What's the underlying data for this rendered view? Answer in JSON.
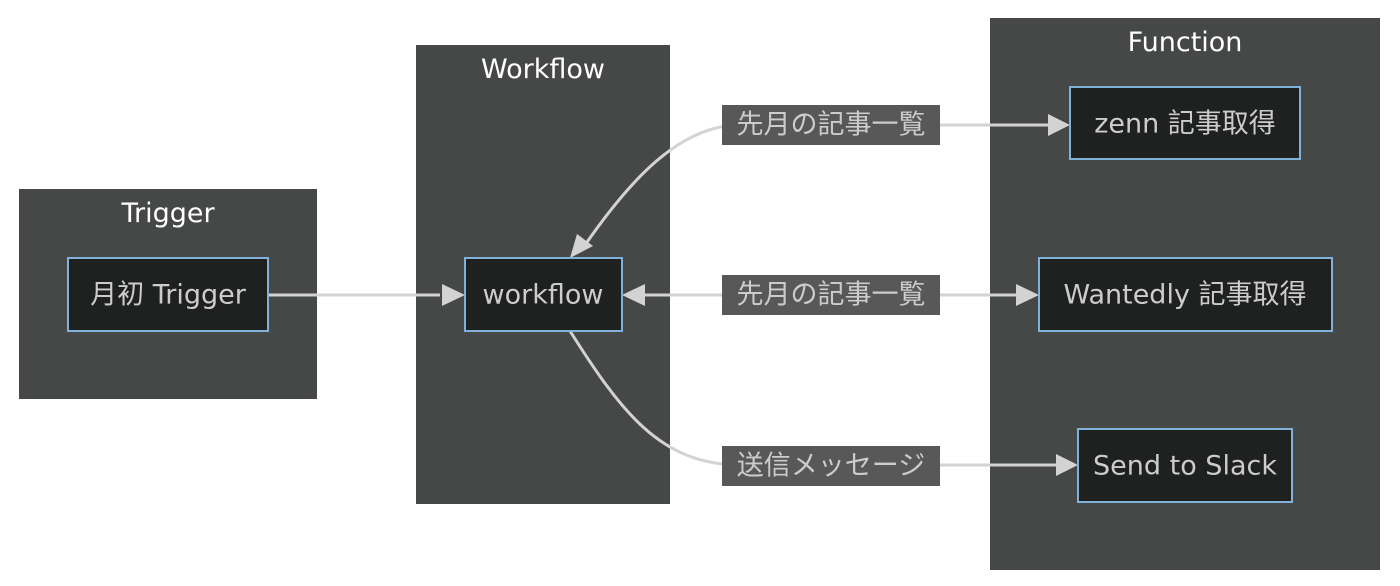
{
  "clusters": {
    "trigger": "Trigger",
    "workflow": "Workflow",
    "function": "Function"
  },
  "nodes": {
    "monthly_trigger": "月初 Trigger",
    "workflow": "workflow",
    "zenn": "zenn 記事取得",
    "wantedly": "Wantedly 記事取得",
    "slack": "Send to Slack"
  },
  "edges": {
    "zenn_label": "先月の記事一覧",
    "wantedly_label": "先月の記事一覧",
    "slack_label": "送信メッセージ"
  },
  "colors": {
    "cluster": "#464847",
    "node_fill": "#1f2020",
    "node_border": "#81b1db",
    "edge": "#d3d3d3",
    "label_bg": "#585858"
  }
}
